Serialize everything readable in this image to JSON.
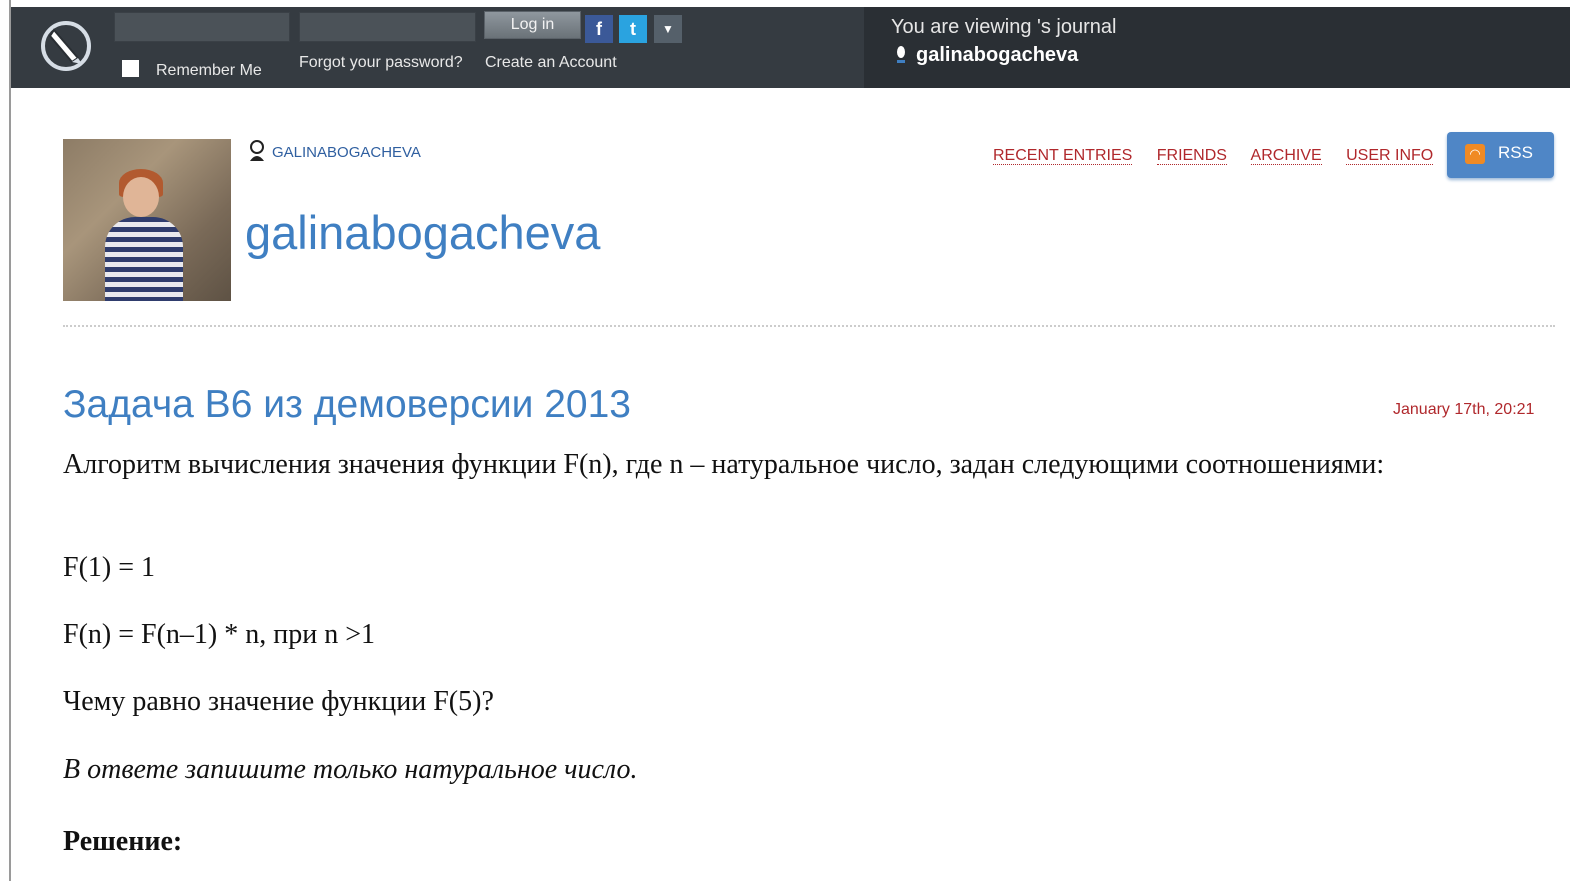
{
  "login": {
    "login_button": "Log in",
    "remember_me": "Remember Me",
    "forgot_password": "Forgot your password?",
    "create_account": "Create an Account",
    "social": [
      "facebook-icon",
      "twitter-icon",
      "chevron-down-icon"
    ]
  },
  "viewing": {
    "text": "You are viewing 's journal",
    "username": "galinabogacheva"
  },
  "header": {
    "user_small": "GALINABOGACHEVA",
    "journal_title": "galinabogacheva",
    "nav": [
      "RECENT ENTRIES",
      "FRIENDS",
      "ARCHIVE",
      "USER INFO"
    ],
    "rss": "RSS"
  },
  "entry": {
    "title": "Задача B6 из демоверсии 2013",
    "date": "January 17th, 20:21",
    "paragraphs": [
      "Алгоритм вычисления значения функции F(n), где n – натуральное число, задан следующими соотношениями:",
      "F(1) = 1",
      "F(n) = F(n–1) * n, при n >1",
      "Чему равно значение функции F(5)?",
      "В ответе запишите только натуральное число.",
      "Решение:"
    ]
  }
}
